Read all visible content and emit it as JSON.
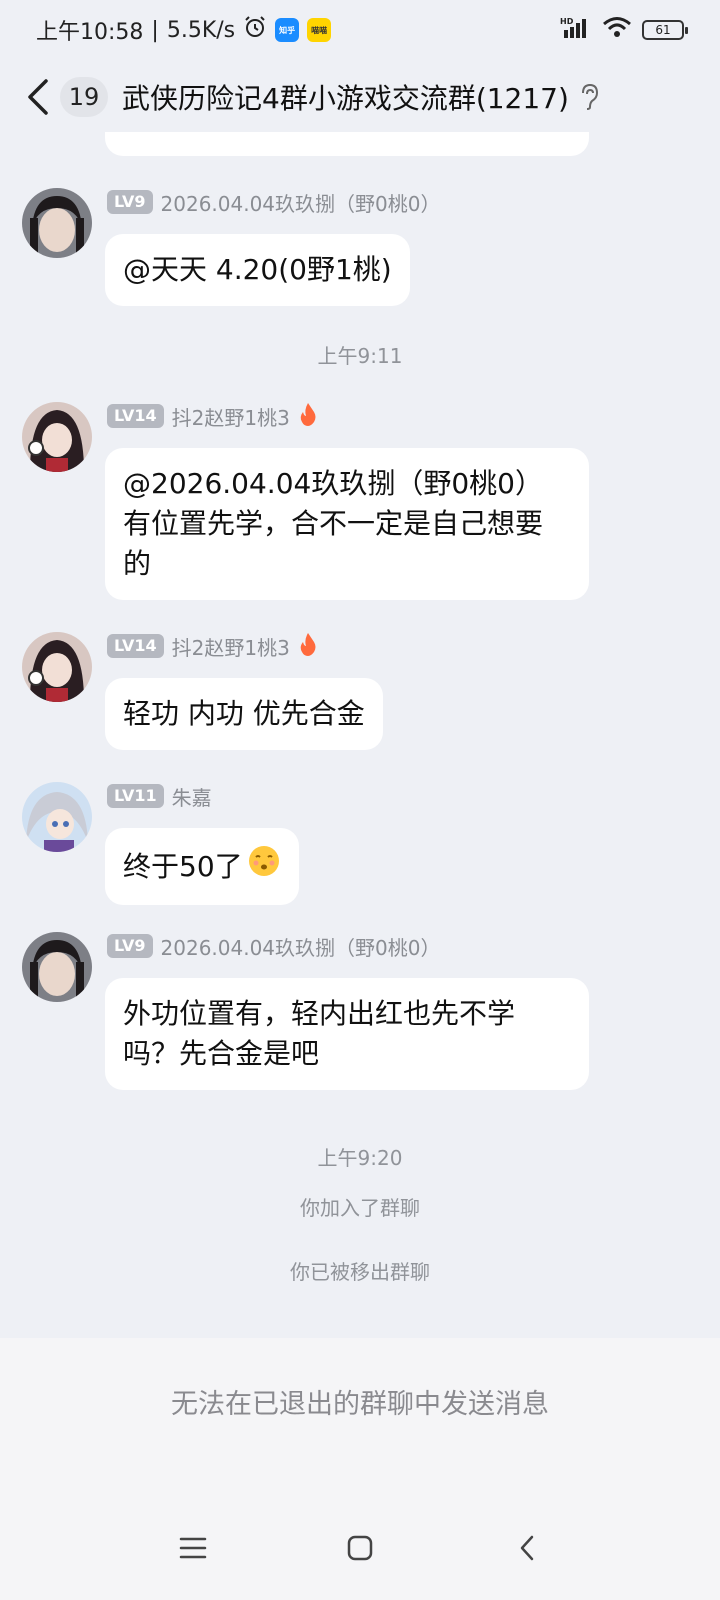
{
  "status_bar": {
    "time": "上午10:58",
    "speed": "5.5K/s",
    "app_badge_1": "知乎",
    "app_badge_2": "喵喵",
    "battery": "61",
    "network": "HD"
  },
  "header": {
    "unread_count": "19",
    "title": "武侠历险记4群小游戏交流群(1217)"
  },
  "messages": [
    {
      "level": "LV9",
      "sender": "2026.04.04玖玖捌（野0桃0）",
      "text": "@天天 4.20(0野1桃)"
    },
    {
      "level": "LV14",
      "sender": "抖2赵野1桃3",
      "text_line1": "@2026.04.04玖玖捌（野0桃0）",
      "text_line2": "有位置先学，合不一定是自己想要",
      "text_line3": "的"
    },
    {
      "level": "LV14",
      "sender": "抖2赵野1桃3",
      "text": "轻功 内功 优先合金"
    },
    {
      "level": "LV11",
      "sender": "朱嘉",
      "text": "终于50了"
    },
    {
      "level": "LV9",
      "sender": "2026.04.04玖玖捌（野0桃0）",
      "text_line1": "外功位置有，轻内出红也先不学",
      "text_line2": "吗？先合金是吧"
    }
  ],
  "timestamps": {
    "t1": "上午9:11",
    "t2": "上午9:20"
  },
  "system": {
    "joined": "你加入了群聊",
    "removed": "你已被移出群聊"
  },
  "bottom": {
    "disabled_message": "无法在已退出的群聊中发送消息"
  },
  "colors": {
    "background": "#eef0f5",
    "bubble": "#ffffff",
    "level_badge": "#b5b8c0",
    "meta_text": "#909399"
  }
}
